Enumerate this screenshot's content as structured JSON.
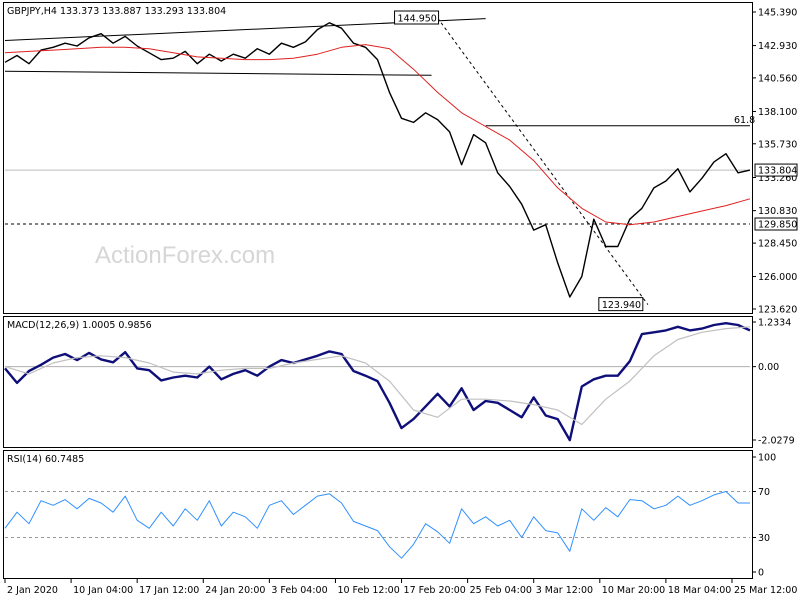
{
  "watermark": "ActionForex.com",
  "chart_data": [
    {
      "type": "line",
      "title": "GBPJPY,H4  133.373 133.887 133.293 133.804",
      "ohlc": {
        "open": 133.373,
        "high": 133.887,
        "low": 133.293,
        "close": 133.804
      },
      "ylim": [
        123.62,
        145.39
      ],
      "y_ticks": [
        145.39,
        142.93,
        140.56,
        138.1,
        135.73,
        133.26,
        130.83,
        128.45,
        126.0,
        123.62
      ],
      "y_tick_labels": [
        "145.390",
        "142.930",
        "140.560",
        "138.100",
        "135.730",
        "133.260",
        "130.830",
        "128.450",
        "126.000",
        "123.620"
      ],
      "x_ticks": [
        0,
        11,
        22,
        33,
        44,
        55,
        66,
        77,
        88,
        99,
        110,
        121
      ],
      "x_tick_labels": [
        "2 Jan 2020",
        "10 Jan 04:00",
        "17 Jan 12:00",
        "24 Jan 20:00",
        "3 Feb 04:00",
        "10 Feb 12:00",
        "17 Feb 20:00",
        "25 Feb 04:00",
        "3 Mar 12:00",
        "10 Mar 20:00",
        "18 Mar 04:00",
        "25 Mar 12:00"
      ],
      "x_range": [
        0,
        124
      ],
      "series": [
        {
          "role": "price",
          "color": "#000000",
          "x": [
            0,
            2,
            4,
            6,
            8,
            10,
            12,
            14,
            16,
            18,
            20,
            22,
            24,
            26,
            28,
            30,
            32,
            34,
            36,
            38,
            40,
            42,
            44,
            46,
            48,
            50,
            52,
            54,
            56,
            58,
            60,
            62,
            64,
            66,
            68,
            70,
            72,
            74,
            76,
            78,
            80,
            82,
            84,
            86,
            88,
            90,
            92,
            94,
            96,
            98,
            100,
            102,
            104,
            106,
            108,
            110,
            112,
            114,
            116,
            118,
            120,
            122,
            124
          ],
          "values": [
            141.7,
            142.2,
            141.6,
            142.6,
            142.8,
            143.1,
            142.9,
            143.5,
            143.8,
            143.1,
            143.6,
            142.9,
            142.4,
            141.9,
            142.0,
            142.5,
            141.6,
            142.3,
            141.8,
            142.3,
            142.0,
            142.7,
            142.3,
            143.1,
            142.8,
            143.2,
            144.1,
            144.6,
            144.2,
            143.1,
            142.8,
            141.9,
            139.5,
            137.6,
            137.3,
            138.0,
            137.5,
            136.6,
            134.2,
            136.4,
            135.8,
            133.6,
            132.6,
            131.3,
            129.4,
            129.8,
            127.0,
            124.5,
            126.0,
            130.2,
            128.2,
            128.2,
            130.2,
            131.0,
            132.5,
            133.0,
            133.9,
            132.2,
            133.2,
            134.4,
            135.0,
            133.6,
            133.8
          ]
        },
        {
          "role": "moving_average",
          "color": "#e02020",
          "x": [
            0,
            4,
            8,
            12,
            16,
            20,
            24,
            28,
            32,
            36,
            40,
            44,
            48,
            52,
            56,
            60,
            64,
            68,
            72,
            76,
            80,
            84,
            88,
            92,
            96,
            100,
            104,
            108,
            112,
            116,
            120,
            124
          ],
          "values": [
            142.4,
            142.5,
            142.6,
            142.7,
            142.8,
            142.8,
            142.7,
            142.4,
            142.1,
            142.0,
            141.9,
            141.9,
            142.0,
            142.3,
            142.8,
            143.0,
            142.7,
            141.2,
            139.5,
            138.0,
            137.0,
            136.0,
            134.5,
            132.5,
            131.0,
            130.0,
            129.8,
            130.0,
            130.4,
            130.8,
            131.2,
            131.7
          ]
        }
      ],
      "trendlines": [
        {
          "x": [
            0,
            80
          ],
          "y": [
            143.3,
            144.9
          ]
        },
        {
          "x": [
            0,
            71
          ],
          "y": [
            141.05,
            140.75
          ]
        },
        {
          "x": [
            72,
            107
          ],
          "y": [
            144.95,
            123.94
          ]
        }
      ],
      "level_lines": [
        {
          "value": 137.05,
          "label": "61.8",
          "x_start": 80,
          "style": "solid"
        },
        {
          "value": 133.804,
          "label": "133.804",
          "style": "solid-light"
        },
        {
          "value": 129.85,
          "label": "129.850",
          "style": "dashed"
        }
      ],
      "annotations": [
        {
          "text": "144.950",
          "x": 68.5,
          "y": 144.95
        },
        {
          "text": "123.940",
          "x": 102.5,
          "y": 123.94
        }
      ]
    },
    {
      "type": "line",
      "title": "MACD(12,26,9) 1.0005 0.9856",
      "ylim": [
        -2.0279,
        1.2334
      ],
      "y_ticks": [
        1.2334,
        0.0,
        -2.0279
      ],
      "y_tick_labels": [
        "1.2334",
        "0.00",
        "-2.0279"
      ],
      "zero_line": true,
      "series": [
        {
          "role": "macd",
          "color": "#0f0f7a",
          "x": [
            0,
            2,
            4,
            6,
            8,
            10,
            12,
            14,
            16,
            18,
            20,
            22,
            24,
            26,
            28,
            30,
            32,
            34,
            36,
            38,
            40,
            42,
            44,
            46,
            48,
            50,
            52,
            54,
            56,
            58,
            60,
            62,
            64,
            66,
            68,
            70,
            72,
            74,
            76,
            78,
            80,
            82,
            84,
            86,
            88,
            90,
            92,
            94,
            96,
            98,
            100,
            102,
            104,
            106,
            108,
            110,
            112,
            114,
            116,
            118,
            120,
            122,
            124
          ],
          "values": [
            -0.05,
            -0.45,
            -0.12,
            0.05,
            0.25,
            0.35,
            0.18,
            0.38,
            0.2,
            0.12,
            0.4,
            -0.05,
            -0.1,
            -0.38,
            -0.3,
            -0.25,
            -0.3,
            0.0,
            -0.35,
            -0.2,
            -0.1,
            -0.25,
            0.0,
            0.18,
            0.1,
            0.2,
            0.3,
            0.42,
            0.35,
            -0.12,
            -0.25,
            -0.4,
            -1.0,
            -1.7,
            -1.45,
            -1.1,
            -0.75,
            -1.1,
            -0.6,
            -1.2,
            -0.95,
            -1.0,
            -1.2,
            -1.4,
            -0.85,
            -1.35,
            -1.45,
            -2.03,
            -0.55,
            -0.35,
            -0.25,
            -0.25,
            0.15,
            0.9,
            0.95,
            1.0,
            1.1,
            1.0,
            1.05,
            1.15,
            1.2,
            1.15,
            1.0
          ]
        },
        {
          "role": "signal",
          "color": "#c0c0c0",
          "x": [
            0,
            4,
            8,
            12,
            16,
            20,
            24,
            28,
            32,
            36,
            40,
            44,
            48,
            52,
            56,
            60,
            64,
            68,
            72,
            76,
            80,
            84,
            88,
            92,
            96,
            100,
            104,
            108,
            112,
            116,
            120,
            124
          ],
          "values": [
            0.0,
            -0.2,
            0.1,
            0.25,
            0.3,
            0.25,
            0.1,
            -0.15,
            -0.2,
            -0.1,
            -0.05,
            -0.05,
            0.1,
            0.2,
            0.3,
            0.1,
            -0.4,
            -1.2,
            -1.4,
            -0.9,
            -0.9,
            -0.95,
            -1.05,
            -1.2,
            -1.6,
            -0.9,
            -0.4,
            0.3,
            0.75,
            0.95,
            1.05,
            1.1
          ]
        }
      ]
    },
    {
      "type": "line",
      "title": "RSI(14) 60.7485",
      "ylim": [
        0,
        100
      ],
      "y_ticks": [
        100,
        70,
        30,
        0
      ],
      "y_tick_labels": [
        "100",
        "70",
        "30",
        "0"
      ],
      "level_lines": [
        {
          "value": 70,
          "style": "dashed"
        },
        {
          "value": 30,
          "style": "dashed"
        }
      ],
      "series": [
        {
          "role": "rsi",
          "color": "#3090ff",
          "x": [
            0,
            2,
            4,
            6,
            8,
            10,
            12,
            14,
            16,
            18,
            20,
            22,
            24,
            26,
            28,
            30,
            32,
            34,
            36,
            38,
            40,
            42,
            44,
            46,
            48,
            50,
            52,
            54,
            56,
            58,
            60,
            62,
            64,
            66,
            68,
            70,
            72,
            74,
            76,
            78,
            80,
            82,
            84,
            86,
            88,
            90,
            92,
            94,
            96,
            98,
            100,
            102,
            104,
            106,
            108,
            110,
            112,
            114,
            116,
            118,
            120,
            122,
            124
          ],
          "values": [
            38,
            52,
            42,
            62,
            58,
            63,
            55,
            64,
            60,
            52,
            66,
            45,
            38,
            52,
            40,
            55,
            45,
            62,
            40,
            52,
            48,
            38,
            58,
            62,
            50,
            58,
            66,
            68,
            60,
            44,
            40,
            36,
            22,
            12,
            24,
            42,
            35,
            25,
            55,
            42,
            48,
            40,
            45,
            30,
            48,
            36,
            34,
            18,
            55,
            45,
            56,
            48,
            63,
            62,
            55,
            58,
            66,
            58,
            62,
            67,
            70,
            60,
            60
          ]
        }
      ]
    }
  ]
}
